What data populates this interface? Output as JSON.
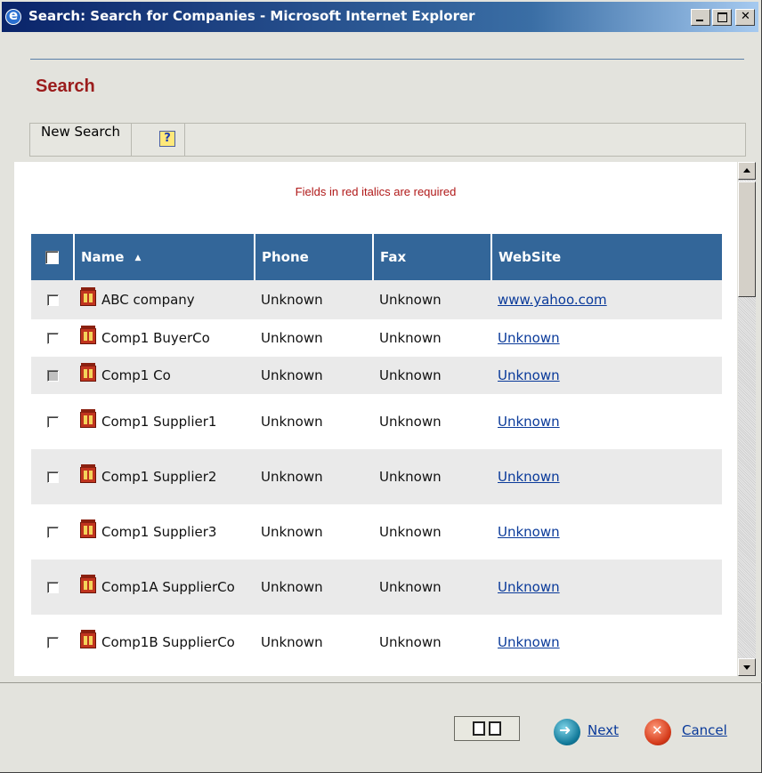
{
  "window": {
    "title": "Search: Search for Companies - Microsoft Internet Explorer"
  },
  "page": {
    "heading": "Search",
    "required_note": "Fields in red italics are required"
  },
  "toolbar": {
    "new_search": "New Search",
    "help_glyph": "?"
  },
  "table": {
    "columns": {
      "name": "Name",
      "phone": "Phone",
      "fax": "Fax",
      "website": "WebSite",
      "sort_indicator": "▲"
    },
    "rows": [
      {
        "name": "ABC company",
        "phone": "Unknown",
        "fax": "Unknown",
        "website": "www.yahoo.com"
      },
      {
        "name": "Comp1 BuyerCo",
        "phone": "Unknown",
        "fax": "Unknown",
        "website": "Unknown"
      },
      {
        "name": "Comp1 Co",
        "phone": "Unknown",
        "fax": "Unknown",
        "website": "Unknown"
      },
      {
        "name": "Comp1 Supplier1",
        "phone": "Unknown",
        "fax": "Unknown",
        "website": "Unknown"
      },
      {
        "name": "Comp1 Supplier2",
        "phone": "Unknown",
        "fax": "Unknown",
        "website": "Unknown"
      },
      {
        "name": "Comp1 Supplier3",
        "phone": "Unknown",
        "fax": "Unknown",
        "website": "Unknown"
      },
      {
        "name": "Comp1A SupplierCo",
        "phone": "Unknown",
        "fax": "Unknown",
        "website": "Unknown"
      },
      {
        "name": "Comp1B SupplierCo",
        "phone": "Unknown",
        "fax": "Unknown",
        "website": "Unknown"
      }
    ]
  },
  "footer": {
    "next": "Next",
    "cancel": "Cancel"
  },
  "colors": {
    "heading": "#9b1c1c",
    "table_header": "#336699",
    "link": "#0a3a9a"
  }
}
